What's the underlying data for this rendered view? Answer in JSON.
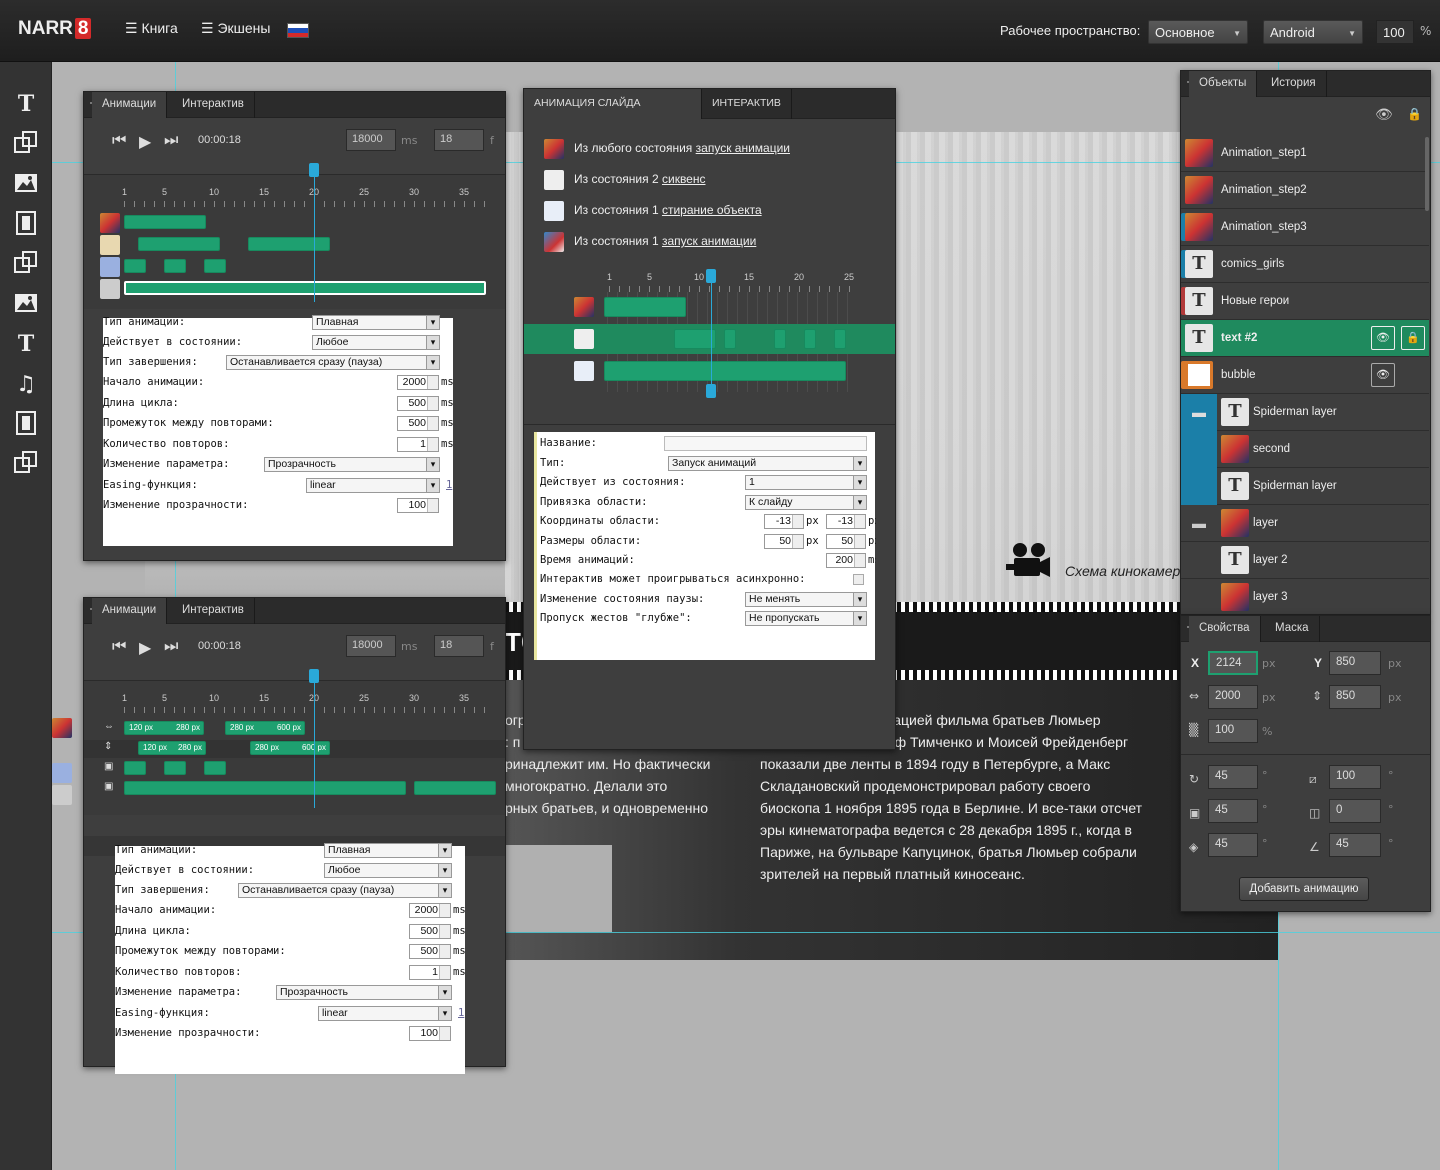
{
  "topbar": {
    "logo_text": "NARR",
    "logo_num": "8",
    "nav": [
      {
        "label": "Книга"
      },
      {
        "label": "Экшены"
      }
    ],
    "workspace_label": "Рабочее пространство:",
    "workspace_value": "Основное",
    "platform_value": "Android",
    "zoom_value": "100",
    "zoom_unit": "%"
  },
  "anim_panel": {
    "tabs": [
      "Анимации",
      "Интерактив"
    ],
    "time": "00:00:18",
    "ms_value": "18000",
    "ms_unit": "ms",
    "frames_value": "18",
    "frames_unit": "f",
    "ruler": [
      "1",
      "5",
      "10",
      "15",
      "20",
      "25",
      "30",
      "35"
    ],
    "playhead_frame": 20,
    "form": {
      "rows": [
        {
          "label": "Тип анимации:",
          "value": "Плавная"
        },
        {
          "label": "Действует в состоянии:",
          "value": "Любое"
        },
        {
          "label": "Тип завершения:",
          "value": "Останавливается сразу (пауза)"
        },
        {
          "label": "Начало анимации:",
          "value": "2000",
          "unit": "ms"
        },
        {
          "label": "Длина цикла:",
          "value": "500",
          "unit": "ms"
        },
        {
          "label": "Промежуток между повторами:",
          "value": "500",
          "unit": "ms"
        },
        {
          "label": "Количество повторов:",
          "value": "1",
          "unit": "ms"
        },
        {
          "label": "Изменение параметра:",
          "value": "Прозрачность"
        },
        {
          "label": "Easing-функция:",
          "value": "linear",
          "extra": "1"
        },
        {
          "label": "Изменение прозрачности:",
          "value": "100"
        }
      ]
    }
  },
  "anim_panel2": {
    "tabs": [
      "Анимации",
      "Интерактив"
    ],
    "time": "00:00:18",
    "ms_value": "18000",
    "ms_unit": "ms",
    "frames_value": "18",
    "frames_unit": "f",
    "ruler": [
      "1",
      "5",
      "10",
      "15",
      "20",
      "25",
      "30",
      "35"
    ],
    "labels": [
      "120 px",
      "280 px",
      "280 px",
      "600 px",
      "120 px",
      "280 px",
      "280 px",
      "600 px"
    ]
  },
  "slide_panel": {
    "tabs": [
      "АНИМАЦИЯ СЛАЙДА",
      "ИНТЕРАКТИВ"
    ],
    "items": [
      {
        "prefix": "Из любого состояния",
        "link": "запуск анимации"
      },
      {
        "prefix": "Из состояния 2",
        "link": "сиквенс"
      },
      {
        "prefix": "Из состояния 1",
        "link": "стирание объекта"
      },
      {
        "prefix": "Из состояния 1",
        "link": "запуск анимации"
      }
    ],
    "ruler": [
      "1",
      "5",
      "10",
      "15",
      "20",
      "25"
    ],
    "form": {
      "rows": [
        {
          "label": "Название:",
          "value": ""
        },
        {
          "label": "Тип:",
          "value": "Запуск анимаций"
        },
        {
          "label": "Действует из состояния:",
          "value": "1"
        },
        {
          "label": "Привязка области:",
          "value": "К слайду"
        },
        {
          "label": "Координаты области:",
          "v1": "-13",
          "u1": "px",
          "v2": "-13",
          "u2": "px"
        },
        {
          "label": "Размеры области:",
          "v1": "50",
          "u1": "px",
          "v2": "50",
          "u2": "px"
        },
        {
          "label": "Время анимаций:",
          "value": "200",
          "unit": "ms"
        },
        {
          "label": "Интерактив может проигрываться асинхронно:"
        },
        {
          "label": "Изменение состояния паузы:",
          "value": "Не менять"
        },
        {
          "label": "Пропуск жестов \"глубже\":",
          "value": "Не пропускать"
        }
      ]
    }
  },
  "objects_panel": {
    "tabs": [
      "Объекты",
      "История"
    ],
    "items": [
      {
        "name": "Animation_step1",
        "icon": "comic-thumb"
      },
      {
        "name": "Animation_step2",
        "icon": "comic-thumb"
      },
      {
        "name": "Animation_step3",
        "icon": "comic-thumb"
      },
      {
        "name": "comics_girls",
        "icon": "text-icon"
      },
      {
        "name": "Новые герои",
        "icon": "text-icon"
      },
      {
        "name": "text #2",
        "icon": "text-icon"
      },
      {
        "name": "bubble",
        "icon": "bubble-icon"
      },
      {
        "name": "Spiderman layer",
        "icon": "text-icon"
      },
      {
        "name": "second",
        "icon": "comic-thumb"
      },
      {
        "name": "Spiderman layer",
        "icon": "text-icon"
      },
      {
        "name": "layer",
        "icon": "comic-thumb"
      },
      {
        "name": "layer 2",
        "icon": "text-icon"
      },
      {
        "name": "layer 3",
        "icon": "comic-thumb"
      }
    ]
  },
  "props_panel": {
    "tabs": [
      "Свойства",
      "Маска"
    ],
    "x_label": "X",
    "x": "2124",
    "y_label": "Y",
    "y": "850",
    "w": "2000",
    "h": "850",
    "opacity": "100",
    "px": "px",
    "pct": "%",
    "deg": "°",
    "rot1": "45",
    "skew1": "100",
    "rot2": "45",
    "skew2": "0",
    "rot3": "45",
    "skew3": "45",
    "add_button": "Добавить анимацию"
  },
  "canvas": {
    "caption": "Схема кинокамер",
    "text_right": [
      "страцией фильма братьев Люмьер",
      "осиф Тимченко и Моисей Фрейденберг",
      "показали две ленты в 1894 году в Петербурге, а Макс",
      "Складановский продемонстрировал работу своего",
      "биоскопа 1 ноября 1895 года в Берлине. И все-таки отсчет",
      "эры кинематографа ведется с 28 декабря 1895 г., когда в",
      "Париже, на бульваре Капуцинок, братья Люмьер собрали",
      "зрителей на первый платный киносеанс."
    ],
    "text_left": [
      "огр",
      ": п",
      "ринадлежит им. Но фактически",
      "многократно. Делали это",
      "рных братьев, и одновременно"
    ],
    "title_fragment": "ТС"
  }
}
